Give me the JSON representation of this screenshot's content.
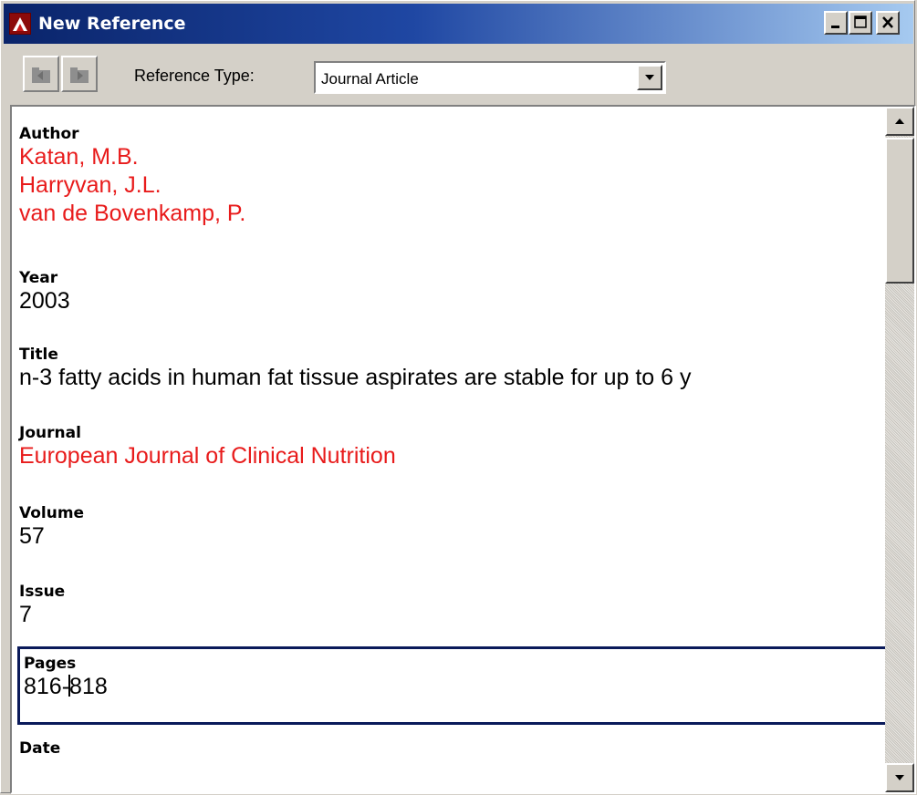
{
  "window": {
    "title": "New Reference",
    "icon": "app-logo-icon",
    "controls": [
      "minimize-icon",
      "maximize-icon",
      "close-icon"
    ]
  },
  "toolbar": {
    "buttons": [
      "prev-reference-icon",
      "next-reference-icon"
    ],
    "reference_type_label": "Reference Type:",
    "reference_type_value": "Journal Article"
  },
  "fields": {
    "author": {
      "label": "Author",
      "values": [
        "Katan, M.B.",
        "Harryvan, J.L.",
        "van de Bovenkamp, P."
      ]
    },
    "year": {
      "label": "Year",
      "value": "2003"
    },
    "title": {
      "label": "Title",
      "value": "n-3 fatty acids in human fat tissue aspirates are stable for up to 6 y"
    },
    "journal": {
      "label": "Journal",
      "value": "European Journal of Clinical Nutrition"
    },
    "volume": {
      "label": "Volume",
      "value": "57"
    },
    "issue": {
      "label": "Issue",
      "value": "7"
    },
    "pages": {
      "label": "Pages",
      "value_before_caret": "816-",
      "value_after_caret": "818"
    },
    "date": {
      "label": "Date",
      "value": ""
    }
  },
  "colors": {
    "title_bar_start": "#0a246a",
    "title_bar_end": "#a6caf0",
    "accent_text": "#e81b1b",
    "focus_border": "#0a1a5a"
  }
}
